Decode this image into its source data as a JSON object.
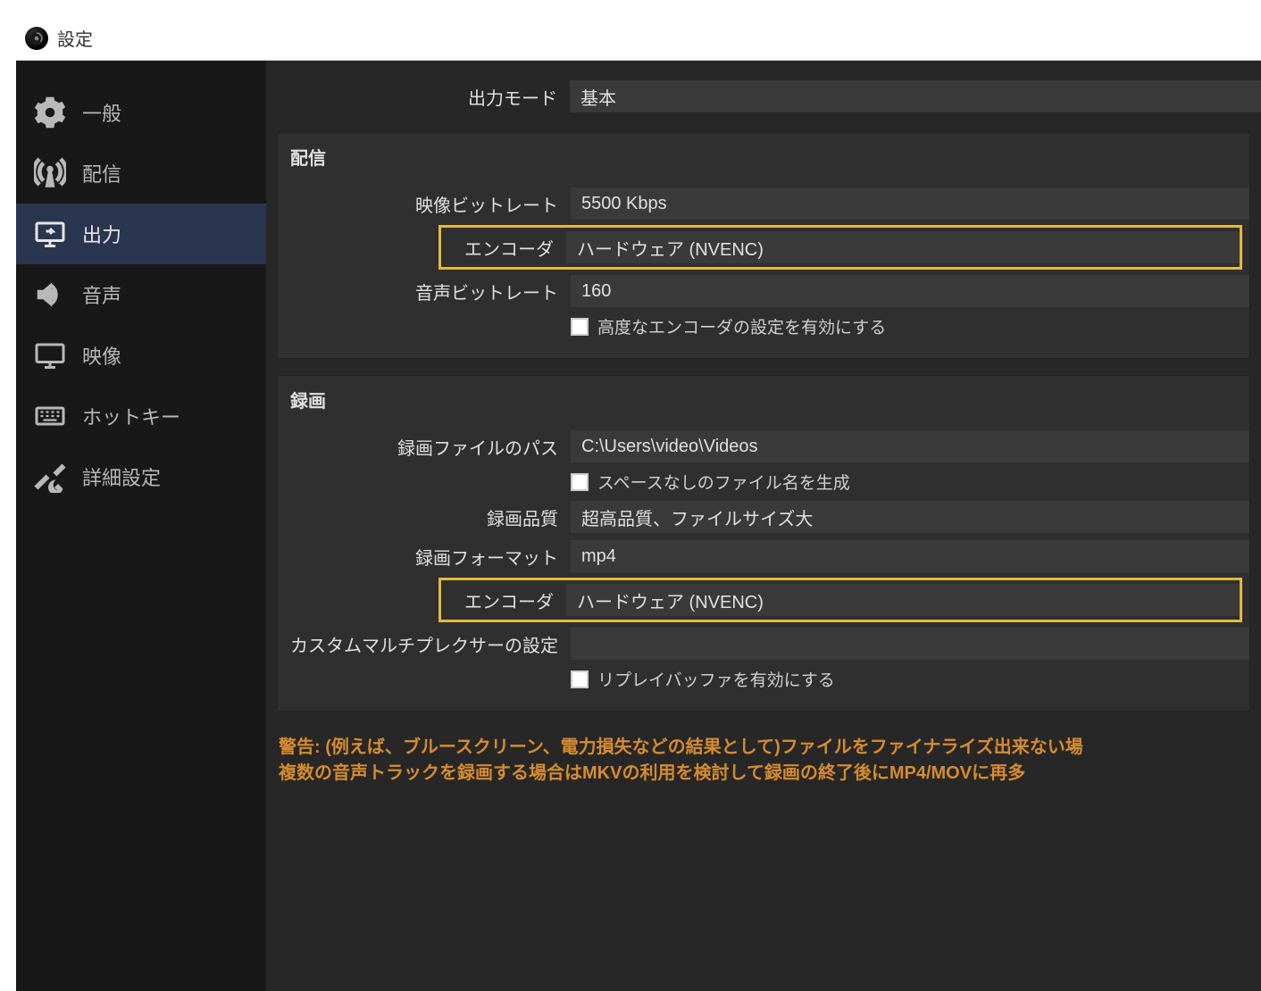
{
  "window": {
    "title": "設定"
  },
  "sidebar": {
    "items": [
      {
        "id": "general",
        "label": "一般"
      },
      {
        "id": "stream",
        "label": "配信"
      },
      {
        "id": "output",
        "label": "出力"
      },
      {
        "id": "audio",
        "label": "音声"
      },
      {
        "id": "video",
        "label": "映像"
      },
      {
        "id": "hotkeys",
        "label": "ホットキー"
      },
      {
        "id": "advanced",
        "label": "詳細設定"
      }
    ],
    "active": "output"
  },
  "output": {
    "mode_label": "出力モード",
    "mode_value": "基本",
    "stream": {
      "title": "配信",
      "video_bitrate_label": "映像ビットレート",
      "video_bitrate_value": "5500 Kbps",
      "encoder_label": "エンコーダ",
      "encoder_value": "ハードウェア (NVENC)",
      "audio_bitrate_label": "音声ビットレート",
      "audio_bitrate_value": "160",
      "advanced_enc_label": "高度なエンコーダの設定を有効にする"
    },
    "record": {
      "title": "録画",
      "path_label": "録画ファイルのパス",
      "path_value": "C:\\Users\\video\\Videos",
      "nospace_label": "スペースなしのファイル名を生成",
      "quality_label": "録画品質",
      "quality_value": "超高品質、ファイルサイズ大",
      "format_label": "録画フォーマット",
      "format_value": "mp4",
      "encoder_label": "エンコーダ",
      "encoder_value": "ハードウェア (NVENC)",
      "muxer_label": "カスタムマルチプレクサーの設定",
      "muxer_value": "",
      "replay_label": "リプレイバッファを有効にする"
    },
    "warning_line1": "警告: (例えば、ブルースクリーン、電力損失などの結果として)ファイルをファイナライズ出来ない場",
    "warning_line2": "複数の音声トラックを録画する場合はMKVの利用を検討して録画の終了後にMP4/MOVに再多"
  }
}
